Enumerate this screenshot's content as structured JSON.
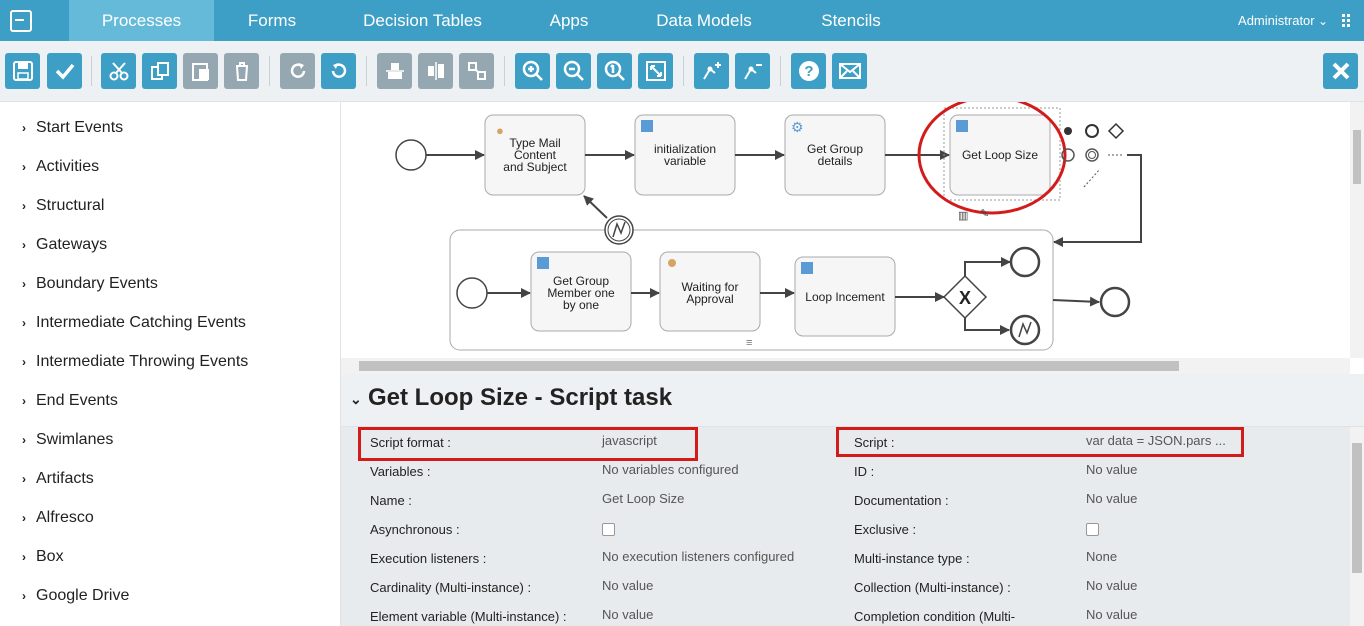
{
  "nav": {
    "tabs": [
      "Processes",
      "Forms",
      "Decision Tables",
      "Apps",
      "Data Models",
      "Stencils"
    ],
    "user": "Administrator"
  },
  "toolbar": {
    "buttons": [
      "save-icon",
      "validate-check-icon",
      "cut-icon",
      "copy-icon",
      "paste-icon",
      "delete-icon",
      "redo-icon",
      "undo-icon",
      "align-horizontal-icon",
      "align-vertical-icon",
      "same-size-icon",
      "zoom-in-icon",
      "zoom-out-icon",
      "zoom-actual-icon",
      "zoom-fit-icon",
      "bend-point-add-icon",
      "bend-point-remove-icon",
      "help-icon",
      "feedback-mail-icon",
      "close-icon"
    ]
  },
  "sidebar": {
    "items": [
      "Start Events",
      "Activities",
      "Structural",
      "Gateways",
      "Boundary Events",
      "Intermediate Catching Events",
      "Intermediate Throwing Events",
      "End Events",
      "Swimlanes",
      "Artifacts",
      "Alfresco",
      "Box",
      "Google Drive"
    ]
  },
  "diagram": {
    "tasks": {
      "type_mail": [
        "Type Mail",
        "Content",
        "and Subject"
      ],
      "init_var": [
        "initialization",
        "variable"
      ],
      "get_group": [
        "Get Group",
        "details"
      ],
      "get_loop": [
        "Get Loop Size"
      ],
      "get_member": [
        "Get Group",
        "Member one",
        "by one"
      ],
      "waiting": [
        "Waiting for",
        "Approval"
      ],
      "loop_inc": [
        "Loop Incement"
      ]
    },
    "gateway_label": "X"
  },
  "properties": {
    "title": "Get Loop Size - Script task",
    "left": [
      {
        "label": "Script format :",
        "value": "javascript"
      },
      {
        "label": "Variables :",
        "value": "No variables configured"
      },
      {
        "label": "Name :",
        "value": "Get Loop Size"
      },
      {
        "label": "Asynchronous :",
        "value": ""
      },
      {
        "label": "Execution listeners :",
        "value": "No execution listeners configured"
      },
      {
        "label": "Cardinality (Multi-instance) :",
        "value": "No value"
      },
      {
        "label": "Element variable (Multi-instance) :",
        "value": "No value"
      }
    ],
    "right": [
      {
        "label": "Script :",
        "value": "var data = JSON.pars ..."
      },
      {
        "label": "ID :",
        "value": "No value"
      },
      {
        "label": "Documentation :",
        "value": "No value"
      },
      {
        "label": "Exclusive :",
        "value": ""
      },
      {
        "label": "Multi-instance type :",
        "value": "None"
      },
      {
        "label": "Collection (Multi-instance) :",
        "value": "No value"
      },
      {
        "label": "Completion condition (Multi-",
        "value": "No value"
      }
    ]
  },
  "colors": {
    "accent": "#3d9fc5",
    "highlight": "#d31b1b",
    "task_fill": "#f6f6f6"
  }
}
